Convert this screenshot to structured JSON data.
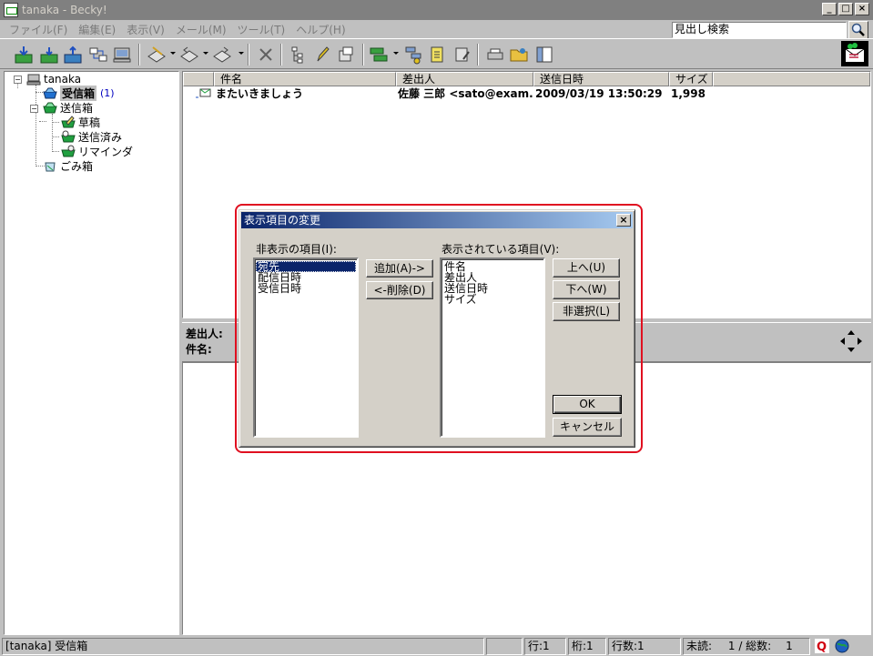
{
  "window": {
    "title": "tanaka - Becky!",
    "minimize": "_",
    "maximize": "□",
    "close": "×"
  },
  "menu": {
    "items": [
      "ファイル(F)",
      "編集(E)",
      "表示(V)",
      "メール(M)",
      "ツール(T)",
      "ヘルプ(H)"
    ]
  },
  "search": {
    "placeholder": "見出し検索"
  },
  "tree": {
    "root": "tanaka",
    "inbox": "受信箱",
    "inbox_count": "(1)",
    "outbox": "送信箱",
    "drafts": "草稿",
    "sent": "送信済み",
    "reminder": "リマインダ",
    "trash": "ごみ箱"
  },
  "list": {
    "headers": [
      "件名",
      "差出人",
      "送信日時",
      "サイズ"
    ],
    "rows": [
      {
        "subject": "またいきましょう",
        "sender": "佐藤 三郎 <sato@exam...",
        "date": "2009/03/19 13:50:29",
        "size": "1,998"
      }
    ]
  },
  "preview": {
    "from_label": "差出人:",
    "subject_label": "件名:"
  },
  "dialog": {
    "title": "表示項目の変更",
    "close": "×",
    "hidden_label": "非表示の項目(I):",
    "hidden_items": [
      "宛先",
      "配信日時",
      "受信日時"
    ],
    "shown_label": "表示されている項目(V):",
    "shown_items": [
      "件名",
      "差出人",
      "送信日時",
      "サイズ"
    ],
    "add_button": "追加(A)->",
    "remove_button": "<-削除(D)",
    "up_button": "上へ(U)",
    "down_button": "下へ(W)",
    "deselect_button": "非選択(L)",
    "ok_button": "OK",
    "cancel_button": "キャンセル"
  },
  "status": {
    "folder": "[tanaka] 受信箱",
    "line": "行:1",
    "column": "桁:1",
    "line_count": "行数:1",
    "unread": "未読:",
    "unread_total": "1 / 総数:",
    "total": "1"
  },
  "colors": {
    "highlight_ring": "#e01020",
    "dialog_title_start": "#0a246a",
    "dialog_title_end": "#a6caf0",
    "selection": "#0a246a"
  }
}
